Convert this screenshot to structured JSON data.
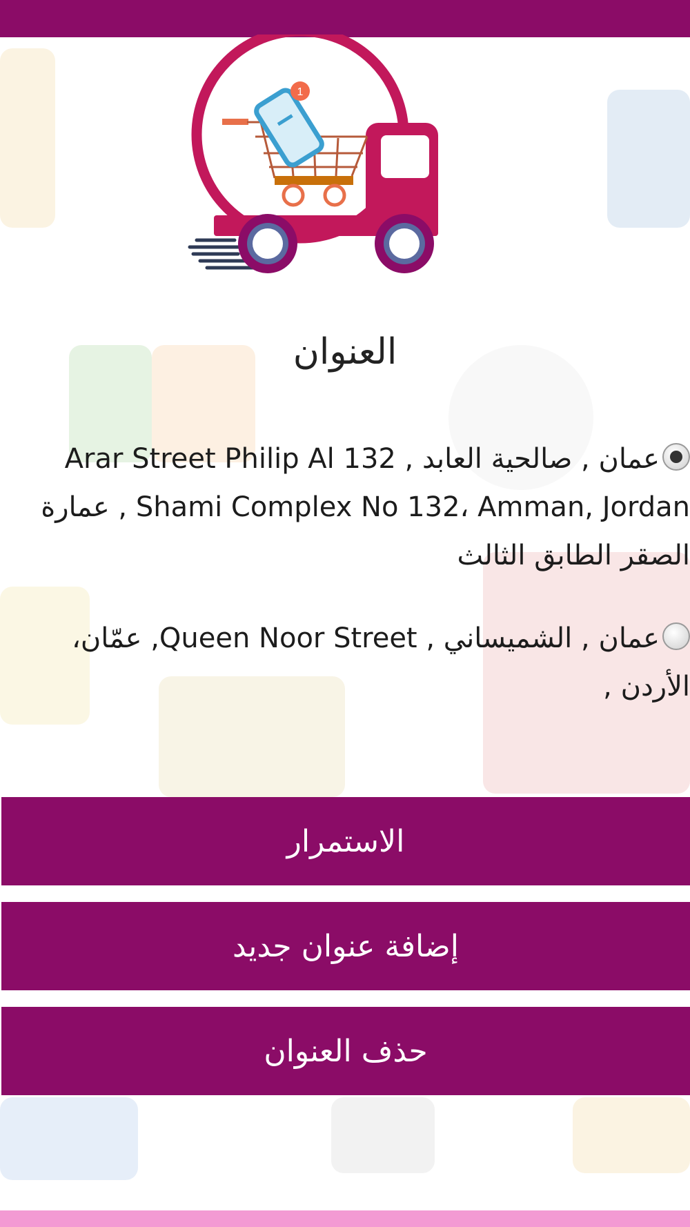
{
  "colors": {
    "brand": "#8b0c67",
    "footer": "#f39ad3",
    "logo_magenta": "#c2185b"
  },
  "logo": {
    "badge_count": "1"
  },
  "page": {
    "title": "العنوان"
  },
  "addresses": [
    {
      "selected": true,
      "text": "عمان , صالحية العابد , Arar Street Philip Al 132 Shami Complex No 132، Amman, Jordan , عمارة الصقر الطابق الثالث"
    },
    {
      "selected": false,
      "text": "عمان , الشميساني , Queen Noor Street, عمّان، الأردن ,"
    }
  ],
  "buttons": {
    "continue": "الاستمرار",
    "add_address": "إضافة عنوان جديد",
    "delete_address": "حذف العنوان"
  }
}
